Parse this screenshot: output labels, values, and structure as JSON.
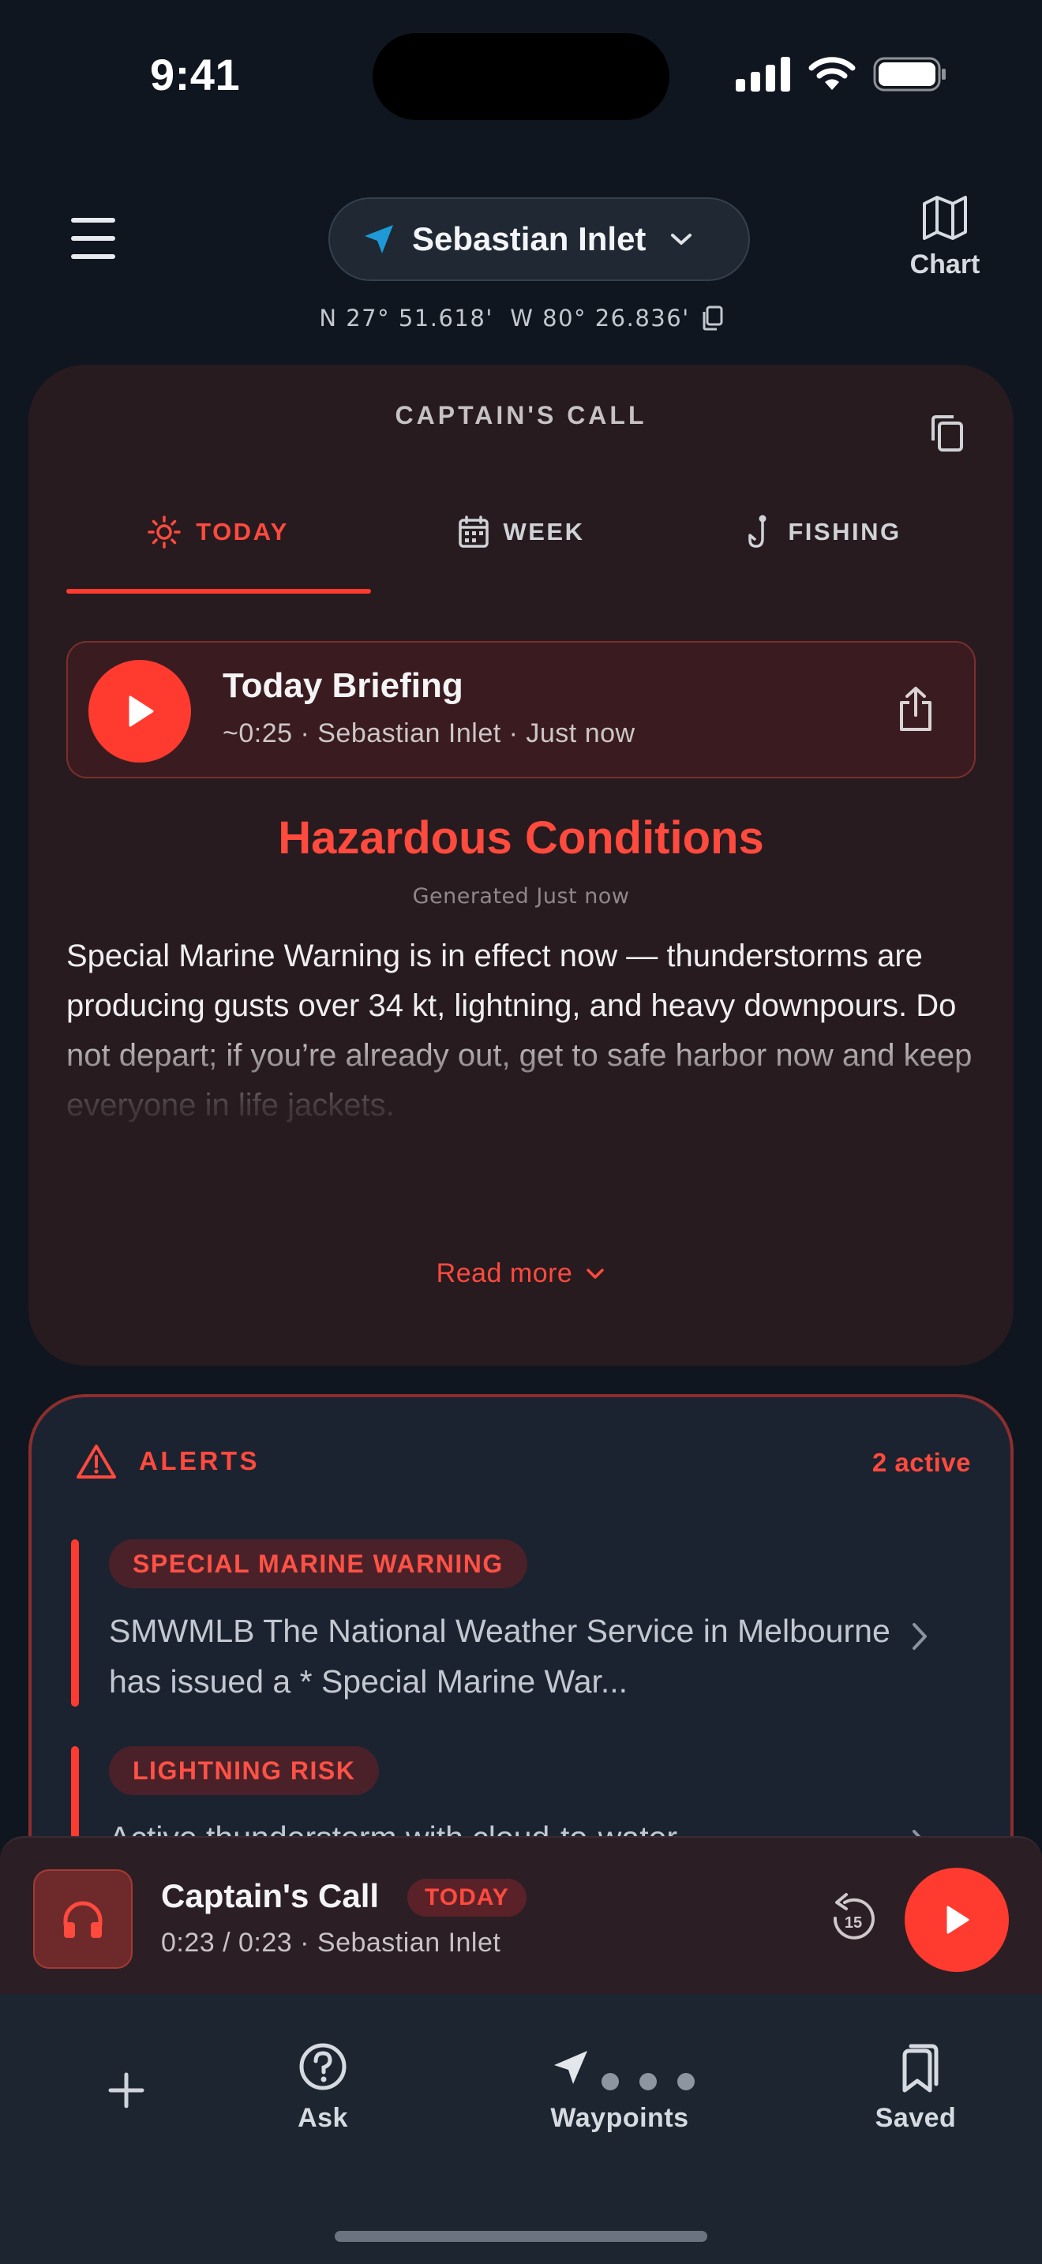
{
  "status_bar": {
    "time": "9:41"
  },
  "header": {
    "location": "Sebastian Inlet",
    "chart_label": "Chart",
    "coordinates": "N 27° 51.618'  W 80° 26.836'"
  },
  "captains_call": {
    "title": "CAPTAIN'S CALL",
    "tabs": [
      {
        "label": "TODAY",
        "icon": "sun-icon",
        "active": true
      },
      {
        "label": "WEEK",
        "icon": "calendar-icon",
        "active": false
      },
      {
        "label": "FISHING",
        "icon": "fishhook-icon",
        "active": false
      }
    ],
    "briefing": {
      "title": "Today Briefing",
      "subtitle": "~0:25 · Sebastian Inlet · Just now"
    },
    "headline": "Hazardous Conditions",
    "generated": "Generated Just now",
    "summary": "Special Marine Warning is in effect now — thunderstorms are producing gusts over 34 kt, lightning, and heavy downpours. Do not depart; if you’re already out, get to safe harbor now and keep everyone in life jackets.",
    "read_more": "Read more"
  },
  "alerts": {
    "label": "ALERTS",
    "count": "2 active",
    "items": [
      {
        "tag": "SPECIAL MARINE WARNING",
        "text": "SMWMLB The National Weather Service in Melbourne has issued a * Special Marine War..."
      },
      {
        "tag": "LIGHTNING RISK",
        "text": "Active thunderstorm with cloud-to-water"
      }
    ]
  },
  "player": {
    "title": "Captain's Call",
    "badge": "TODAY",
    "subtitle": "0:23 / 0:23 · Sebastian Inlet",
    "skip_label": "15"
  },
  "bottom_nav": {
    "items": [
      {
        "label": "",
        "icon": "plus-icon"
      },
      {
        "label": "Ask",
        "icon": "question-icon"
      },
      {
        "label": "Waypoints",
        "icon": "navigation-arrow-icon"
      },
      {
        "label": "Saved",
        "icon": "bookmarks-icon"
      }
    ]
  },
  "colors": {
    "accent": "#ff3b30",
    "background": "#10161f",
    "card": "#271b1f",
    "alert_card": "#1c2330"
  }
}
